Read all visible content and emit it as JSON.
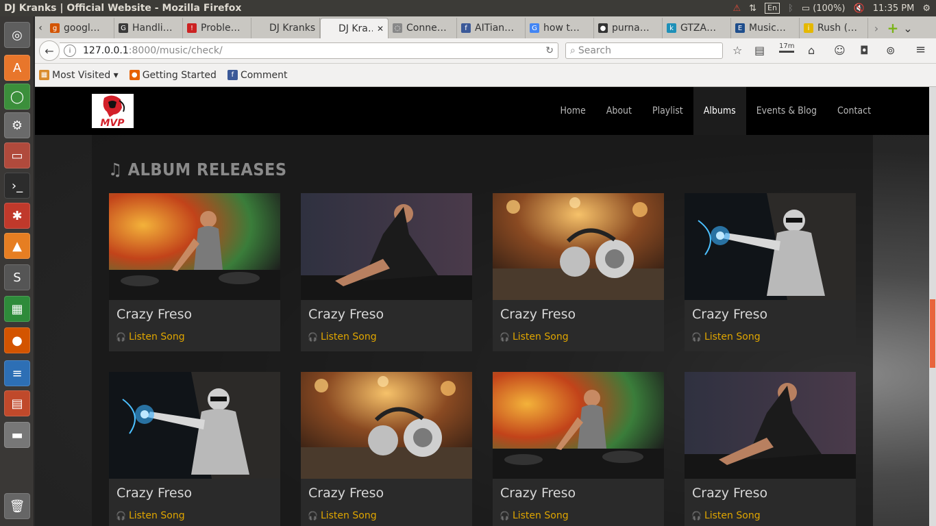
{
  "os": {
    "window_title": "DJ Kranks | Official Website - Mozilla Firefox",
    "lang": "En",
    "battery": "(100%)",
    "time": "11:35 PM",
    "launcher": [
      {
        "name": "ubuntu-home-icon",
        "glyph": "◎",
        "color": "#5e5e5e"
      },
      {
        "name": "software-center-icon",
        "glyph": "A",
        "color": "#e8762b"
      },
      {
        "name": "update-manager-icon",
        "glyph": "◯",
        "color": "#3b8f3b"
      },
      {
        "name": "system-settings-icon",
        "glyph": "⚙",
        "color": "#6a6a6a"
      },
      {
        "name": "file-manager-icon",
        "glyph": "▭",
        "color": "#b04a3c"
      },
      {
        "name": "terminal-icon",
        "glyph": "›_",
        "color": "#2c2c2c"
      },
      {
        "name": "network-app-icon",
        "glyph": "✱",
        "color": "#c0392b"
      },
      {
        "name": "vlc-icon",
        "glyph": "▲",
        "color": "#e67e22"
      },
      {
        "name": "sublime-text-icon",
        "glyph": "S",
        "color": "#555555"
      },
      {
        "name": "spreadsheet-icon",
        "glyph": "▦",
        "color": "#2e8b3a"
      },
      {
        "name": "firefox-icon",
        "glyph": "●",
        "color": "#d35400"
      },
      {
        "name": "writer-icon",
        "glyph": "≡",
        "color": "#2d6fb5"
      },
      {
        "name": "impress-icon",
        "glyph": "▤",
        "color": "#c0492b"
      },
      {
        "name": "drive-icon",
        "glyph": "▬",
        "color": "#777777"
      },
      {
        "name": "trash-icon",
        "glyph": "🗑",
        "color": "#666666"
      }
    ]
  },
  "browser": {
    "tabs": [
      {
        "label": "googl…",
        "fav": "g",
        "color": "#d35400"
      },
      {
        "label": "Handli…",
        "fav": "G",
        "color": "#3a3a3a"
      },
      {
        "label": "Proble…",
        "fav": "!",
        "color": "#cc2222"
      },
      {
        "label": "DJ Kranks…",
        "fav": "",
        "color": "#c9c7c2"
      },
      {
        "label": "DJ Kra…",
        "fav": "",
        "color": "#f2f1f0",
        "active": true
      },
      {
        "label": "Conne…",
        "fav": "◌",
        "color": "#888888"
      },
      {
        "label": "AITian…",
        "fav": "f",
        "color": "#3b5998"
      },
      {
        "label": "how t…",
        "fav": "G",
        "color": "#4285f4"
      },
      {
        "label": "purna…",
        "fav": "●",
        "color": "#333333"
      },
      {
        "label": "GTZA…",
        "fav": "k",
        "color": "#1e90b8"
      },
      {
        "label": "Music…",
        "fav": "E",
        "color": "#1f4e8c"
      },
      {
        "label": "Rush (…",
        "fav": "i",
        "color": "#e5b800"
      }
    ],
    "url_host": "127.0.0.1",
    "url_rest": ":8000/music/check/",
    "search_placeholder": "Search",
    "badge": "17m",
    "bookmarks": [
      {
        "label": "Most Visited ▾",
        "color": "#d98b2b",
        "glyph": "▦"
      },
      {
        "label": "Getting Started",
        "color": "#e66000",
        "glyph": "●"
      },
      {
        "label": "Comment",
        "color": "#3b5998",
        "glyph": "f"
      }
    ]
  },
  "site": {
    "logo_text": "MVP",
    "nav": [
      "Home",
      "About",
      "Playlist",
      "Albums",
      "Events & Blog",
      "Contact"
    ],
    "active_nav": "Albums",
    "heading": "ALBUM RELEASES",
    "albums": [
      {
        "title": "Crazy Freso",
        "link": "Listen Song",
        "art": "a"
      },
      {
        "title": "Crazy Freso",
        "link": "Listen Song",
        "art": "b"
      },
      {
        "title": "Crazy Freso",
        "link": "Listen Song",
        "art": "c"
      },
      {
        "title": "Crazy Freso",
        "link": "Listen Song",
        "art": "d"
      },
      {
        "title": "Crazy Freso",
        "link": "Listen Song",
        "art": "d"
      },
      {
        "title": "Crazy Freso",
        "link": "Listen Song",
        "art": "c"
      },
      {
        "title": "Crazy Freso",
        "link": "Listen Song",
        "art": "a"
      },
      {
        "title": "Crazy Freso",
        "link": "Listen Song",
        "art": "b"
      }
    ]
  }
}
